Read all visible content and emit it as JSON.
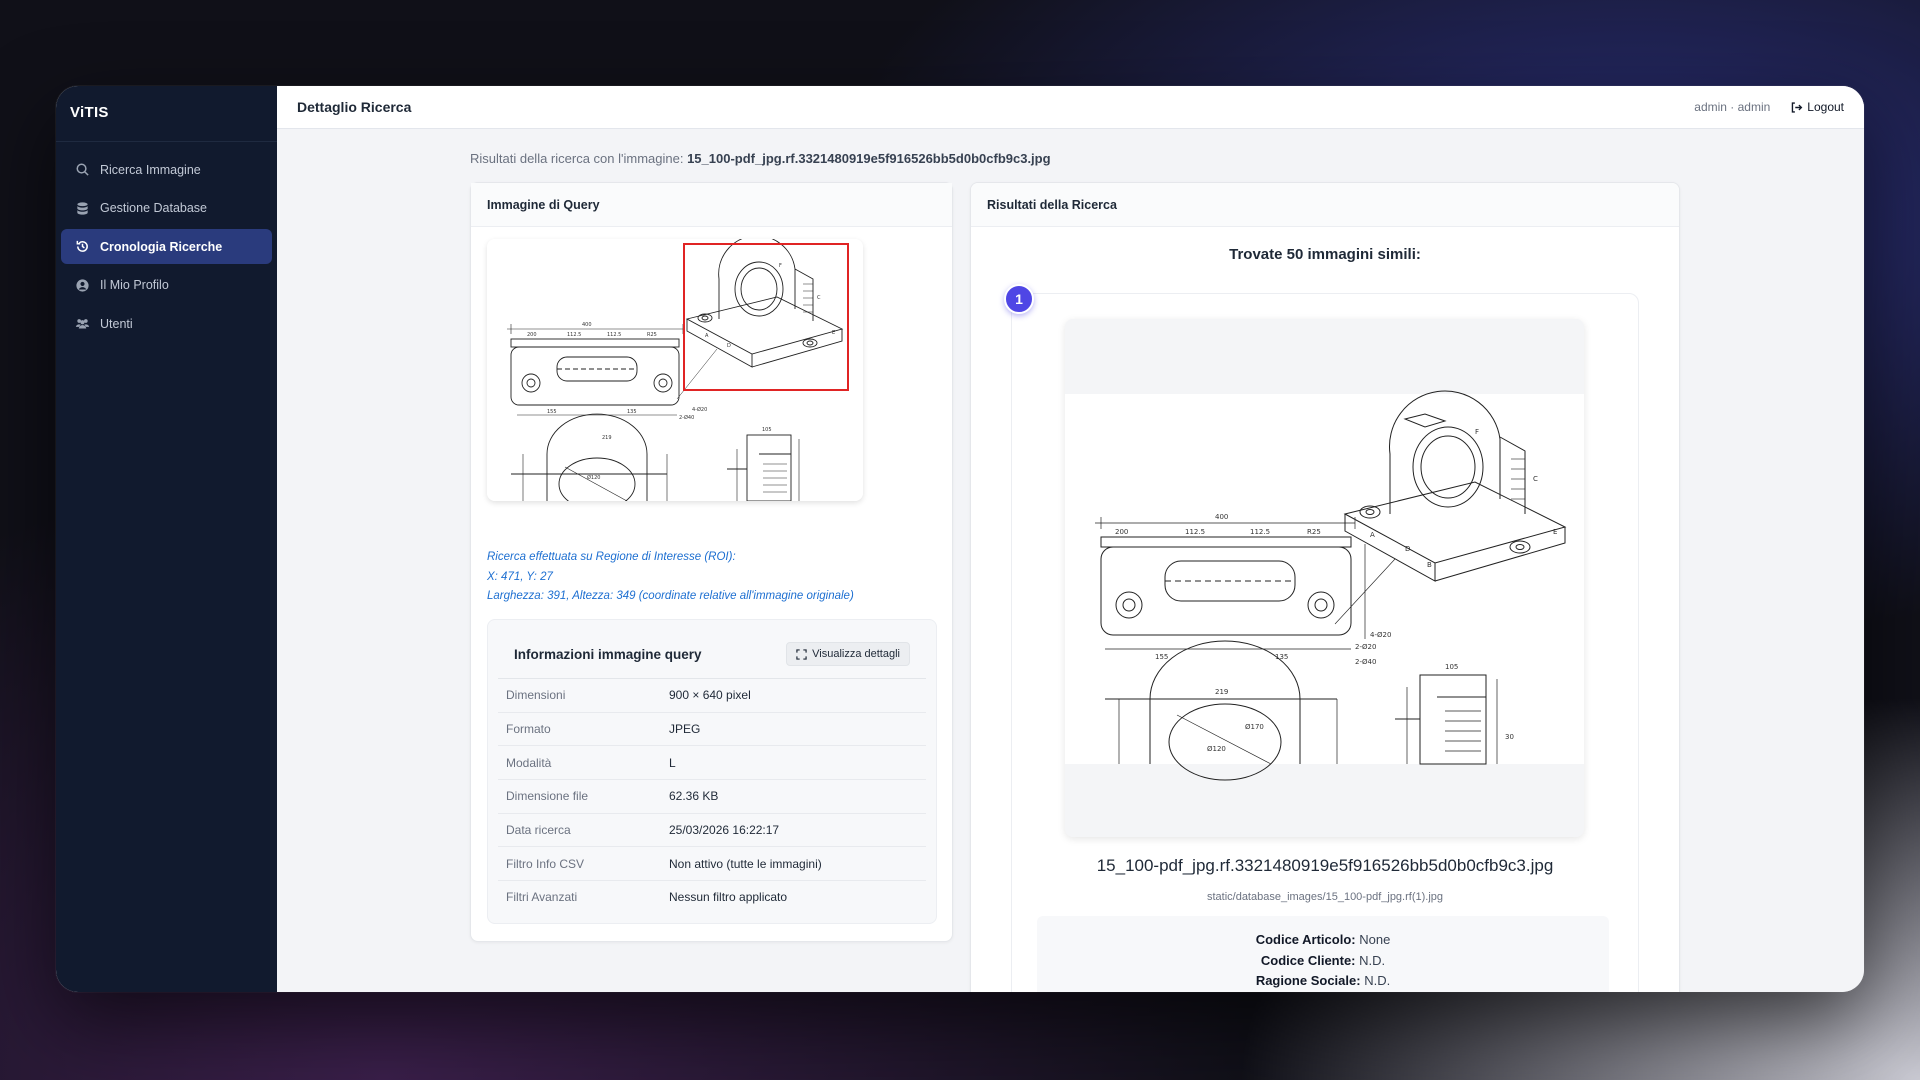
{
  "app": {
    "brand": "ViTIS"
  },
  "sidebar": {
    "items": [
      {
        "label": "Ricerca Immagine",
        "icon": "search-icon"
      },
      {
        "label": "Gestione Database",
        "icon": "database-icon"
      },
      {
        "label": "Cronologia Ricerche",
        "icon": "history-icon",
        "active": true
      },
      {
        "label": "Il Mio Profilo",
        "icon": "user-circle-icon"
      },
      {
        "label": "Utenti",
        "icon": "users-icon"
      }
    ]
  },
  "header": {
    "title": "Dettaglio Ricerca",
    "user": "admin · admin",
    "logout_label": "Logout"
  },
  "search": {
    "subtitle_prefix": "Risultati della ricerca con l'immagine:",
    "query_filename": "15_100-pdf_jpg.rf.3321480919e5f916526bb5d0b0cfb9c3.jpg"
  },
  "query_card": {
    "title": "Immagine di Query",
    "roi_lines": [
      "Ricerca effettuata su Regione di Interesse (ROI):",
      "X: 471, Y: 27",
      "Larghezza: 391, Altezza: 349 (coordinate relative all'immagine originale)"
    ],
    "info": {
      "title": "Informazioni immagine query",
      "details_button": "Visualizza dettagli",
      "rows": [
        {
          "key": "Dimensioni",
          "value": "900 × 640 pixel"
        },
        {
          "key": "Formato",
          "value": "JPEG"
        },
        {
          "key": "Modalità",
          "value": "L"
        },
        {
          "key": "Dimensione file",
          "value": "62.36 KB"
        },
        {
          "key": "Data ricerca",
          "value": "25/03/2026 16:22:17"
        },
        {
          "key": "Filtro Info CSV",
          "value": "Non attivo (tutte le immagini)"
        },
        {
          "key": "Filtri Avanzati",
          "value": "Nessun filtro applicato"
        }
      ]
    }
  },
  "results_card": {
    "title": "Risultati della Ricerca",
    "found_text": "Trovate 50 immagini simili:",
    "results": [
      {
        "rank": "1",
        "filename": "15_100-pdf_jpg.rf.3321480919e5f916526bb5d0b0cfb9c3.jpg",
        "path": "static/database_images/15_100-pdf_jpg.rf(1).jpg",
        "codice_articolo_label": "Codice Articolo:",
        "codice_articolo": "None",
        "codice_cliente_label": "Codice Cliente:",
        "codice_cliente": "N.D.",
        "ragione_sociale_label": "Ragione Sociale:",
        "ragione_sociale": "N.D."
      }
    ]
  },
  "colors": {
    "sidebar_bg": "#111a2e",
    "active_item": "#2a3b7d",
    "accent": "#4f46e5",
    "roi_red": "#e02424",
    "roi_text": "#1d6fd1"
  },
  "drawing_labels": {
    "dims_top": [
      "200",
      "112.5",
      "112.5",
      "R25",
      "400"
    ],
    "dims_bottom": [
      "155",
      "135",
      "219",
      "2-Ø20",
      "2-Ø40",
      "4-Ø20",
      "105",
      "30"
    ],
    "dims_circle": [
      "Ø120",
      "Ø170"
    ],
    "iso_letters": [
      "A",
      "B",
      "C",
      "D",
      "E",
      "F"
    ]
  }
}
